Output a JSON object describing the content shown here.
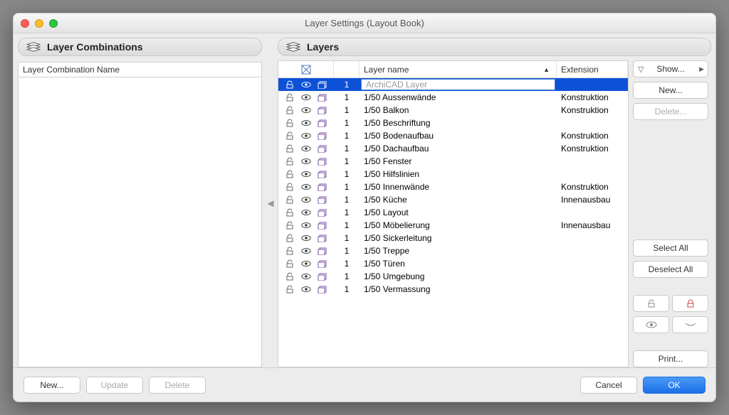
{
  "window": {
    "title": "Layer Settings (Layout Book)"
  },
  "left_panel": {
    "header": "Layer Combinations",
    "column": "Layer Combination Name",
    "buttons": {
      "new": "New...",
      "update": "Update",
      "delete": "Delete"
    }
  },
  "right_panel": {
    "header": "Layers",
    "columns": {
      "name": "Layer name",
      "ext": "Extension"
    }
  },
  "layers": [
    {
      "num": "1",
      "name": "ArchiCAD Layer",
      "ext": "",
      "selected": true
    },
    {
      "num": "1",
      "name": "1/50 Aussenwände",
      "ext": "Konstruktion"
    },
    {
      "num": "1",
      "name": "1/50 Balkon",
      "ext": "Konstruktion"
    },
    {
      "num": "1",
      "name": "1/50 Beschriftung",
      "ext": ""
    },
    {
      "num": "1",
      "name": "1/50 Bodenaufbau",
      "ext": "Konstruktion"
    },
    {
      "num": "1",
      "name": "1/50 Dachaufbau",
      "ext": "Konstruktion"
    },
    {
      "num": "1",
      "name": "1/50 Fenster",
      "ext": ""
    },
    {
      "num": "1",
      "name": "1/50 Hilfslinien",
      "ext": ""
    },
    {
      "num": "1",
      "name": "1/50 Innenwände",
      "ext": "Konstruktion"
    },
    {
      "num": "1",
      "name": "1/50 Küche",
      "ext": "Innenausbau"
    },
    {
      "num": "1",
      "name": "1/50 Layout",
      "ext": ""
    },
    {
      "num": "1",
      "name": "1/50 Möbelierung",
      "ext": "Innenausbau"
    },
    {
      "num": "1",
      "name": "1/50 Sickerleitung",
      "ext": ""
    },
    {
      "num": "1",
      "name": "1/50 Treppe",
      "ext": ""
    },
    {
      "num": "1",
      "name": "1/50 Türen",
      "ext": ""
    },
    {
      "num": "1",
      "name": "1/50 Umgebung",
      "ext": ""
    },
    {
      "num": "1",
      "name": "1/50 Vermassung",
      "ext": ""
    }
  ],
  "side_buttons": {
    "show": "Show...",
    "new": "New...",
    "delete": "Delete...",
    "select_all": "Select All",
    "deselect_all": "Deselect All",
    "print": "Print..."
  },
  "footer": {
    "cancel": "Cancel",
    "ok": "OK"
  }
}
